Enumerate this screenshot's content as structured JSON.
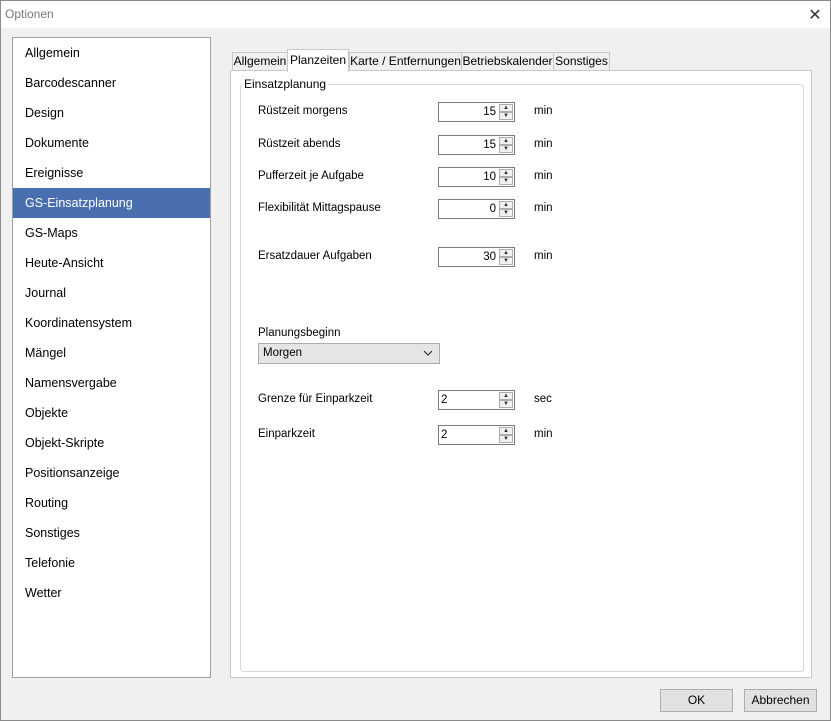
{
  "window": {
    "title": "Optionen",
    "close_glyph": "✕"
  },
  "sidebar": {
    "items": [
      {
        "label": "Allgemein"
      },
      {
        "label": "Barcodescanner"
      },
      {
        "label": "Design"
      },
      {
        "label": "Dokumente"
      },
      {
        "label": "Ereignisse"
      },
      {
        "label": "GS-Einsatzplanung"
      },
      {
        "label": "GS-Maps"
      },
      {
        "label": "Heute-Ansicht"
      },
      {
        "label": "Journal"
      },
      {
        "label": "Koordinatensystem"
      },
      {
        "label": "Mängel"
      },
      {
        "label": "Namensvergabe"
      },
      {
        "label": "Objekte"
      },
      {
        "label": "Objekt-Skripte"
      },
      {
        "label": "Positionsanzeige"
      },
      {
        "label": "Routing"
      },
      {
        "label": "Sonstiges"
      },
      {
        "label": "Telefonie"
      },
      {
        "label": "Wetter"
      }
    ],
    "selected": "GS-Einsatzplanung"
  },
  "tabs": [
    {
      "label": "Allgemein"
    },
    {
      "label": "Planzeiten"
    },
    {
      "label": "Karte / Entfernungen"
    },
    {
      "label": "Betriebskalender"
    },
    {
      "label": "Sonstiges"
    }
  ],
  "active_tab": "Planzeiten",
  "panel": {
    "group_title": "Einsatzplanung",
    "fields": {
      "ruestzeit_morgens": {
        "label": "Rüstzeit morgens",
        "value": "15",
        "unit": "min"
      },
      "ruestzeit_abends": {
        "label": "Rüstzeit abends",
        "value": "15",
        "unit": "min"
      },
      "pufferzeit": {
        "label": "Pufferzeit je Aufgabe",
        "value": "10",
        "unit": "min"
      },
      "flexibilitaet": {
        "label": "Flexibilität Mittagspause",
        "value": "0",
        "unit": "min"
      },
      "ersatzdauer": {
        "label": "Ersatzdauer Aufgaben",
        "value": "30",
        "unit": "min"
      },
      "grenze_einparkzeit": {
        "label": "Grenze für Einparkzeit",
        "value": "2",
        "unit": "sec"
      },
      "einparkzeit": {
        "label": "Einparkzeit",
        "value": "2",
        "unit": "min"
      }
    },
    "planungsbeginn": {
      "label": "Planungsbeginn",
      "value": "Morgen"
    }
  },
  "buttons": {
    "ok": "OK",
    "cancel": "Abbrechen"
  },
  "icons": {
    "spin_up": "▲",
    "spin_down": "▼"
  }
}
